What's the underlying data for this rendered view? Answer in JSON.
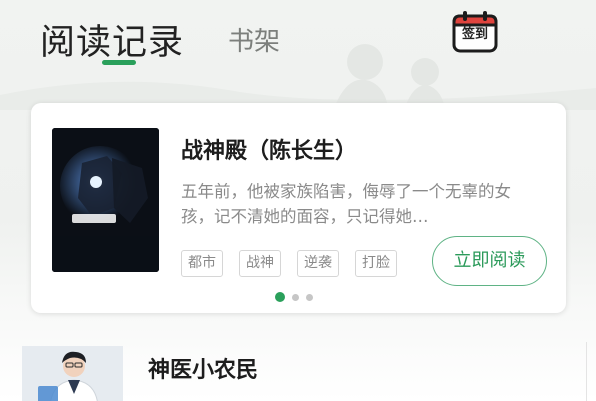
{
  "header": {
    "tabs": [
      {
        "label": "阅读记录",
        "active": true
      },
      {
        "label": "书架",
        "active": false
      }
    ],
    "checkin_label": "签到"
  },
  "featured": {
    "title": "战神殿（陈长生）",
    "description": "五年前，他被家族陷害，侮辱了一个无辜的女孩，记不清她的面容，只记得她…",
    "tags": [
      "都市",
      "战神",
      "逆袭",
      "打脸"
    ],
    "read_button": "立即阅读",
    "cover_text": "战神殿",
    "carousel": {
      "count": 3,
      "active_index": 0
    }
  },
  "list": {
    "items": [
      {
        "title": "神医小农民"
      }
    ]
  },
  "colors": {
    "accent": "#2aa05b",
    "checkin_red": "#e0443e",
    "text_primary": "#1d1d1d",
    "text_secondary": "#8a8a8a"
  }
}
